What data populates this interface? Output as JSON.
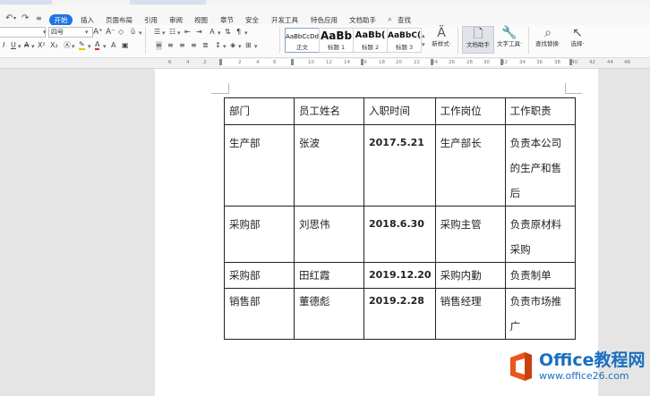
{
  "menubar": {
    "active_tab": "开始",
    "tabs": [
      "插入",
      "页面布局",
      "引用",
      "审阅",
      "视图",
      "章节",
      "安全",
      "开发工具",
      "特色应用",
      "文档助手"
    ],
    "search_label": "查找"
  },
  "ribbon": {
    "font_size": "四号",
    "styles": [
      {
        "sample": "AaBbCcDd",
        "name": "正文"
      },
      {
        "sample": "AaBb",
        "name": "标题 1"
      },
      {
        "sample": "AaBb(",
        "name": "标题 2"
      },
      {
        "sample": "AaBbC(",
        "name": "标题 3"
      }
    ],
    "new_style_label": "新样式·",
    "doc_helper_label": "文档助手",
    "text_tools_label": "文字工具·",
    "find_replace_label": "查找替换·",
    "select_label": "选择·"
  },
  "ruler": {
    "numbers": [
      "6",
      "4",
      "2",
      "2",
      "4",
      "6",
      "8",
      "10",
      "12",
      "14",
      "16",
      "18",
      "20",
      "22",
      "24",
      "26",
      "28",
      "30",
      "32",
      "34",
      "36",
      "38",
      "40",
      "42",
      "44",
      "46"
    ]
  },
  "table": {
    "headers": [
      "部门",
      "员工姓名",
      "入职时间",
      "工作岗位",
      "工作职责"
    ],
    "rows": [
      {
        "dept": "生产部",
        "name": "张波",
        "date": "2017.5.21",
        "post": "生产部长",
        "duty": [
          "负责本公司",
          "的生产和售",
          "后"
        ]
      },
      {
        "dept": "采购部",
        "name": "刘思伟",
        "date": "2018.6.30",
        "post": "采购主管",
        "duty": [
          "负责原材料",
          "采购"
        ]
      },
      {
        "dept": "采购部",
        "name": "田红霞",
        "date": "2019.12.20",
        "post": "采购内勤",
        "duty": [
          "负责制单"
        ]
      },
      {
        "dept": "销售部",
        "name": "董德彪",
        "date": "2019.2.28",
        "post": "销售经理",
        "duty": [
          "负责市场推",
          "广"
        ]
      }
    ]
  },
  "watermark": {
    "title": "Office教程网",
    "url": "www.office26.com",
    "colors": {
      "orange": "#e8561b",
      "blue": "#1a6fbf"
    }
  }
}
